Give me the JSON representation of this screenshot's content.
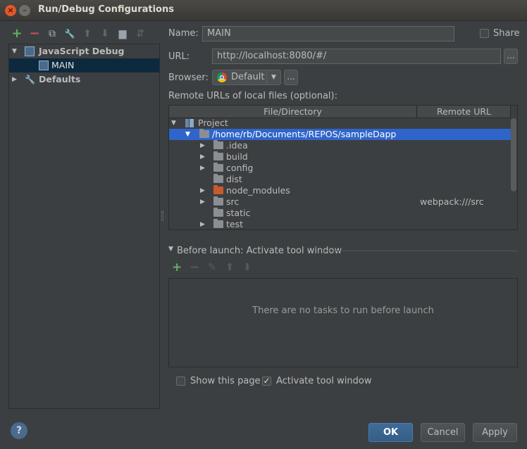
{
  "window": {
    "title": "Run/Debug Configurations",
    "close_glyph": "×",
    "min_glyph": "–"
  },
  "toolbar": {
    "add": "+",
    "remove": "−",
    "copy": "⧉",
    "edit": "🔧",
    "up": "⬆",
    "down": "⬇",
    "folder": "▆",
    "sort": "⇵"
  },
  "tree": {
    "items": [
      {
        "label": "JavaScript Debug",
        "expanded": true
      },
      {
        "label": "MAIN",
        "selected": true
      },
      {
        "label": "Defaults",
        "expanded": false
      }
    ]
  },
  "form": {
    "name_label": "Name:",
    "name_value": "MAIN",
    "share_label": "Share",
    "url_label": "URL:",
    "url_value": "http://localhost:8080/#/",
    "url_more": "...",
    "browser_label": "Browser:",
    "browser_value": "Default",
    "browser_more": "...",
    "remote_urls_label": "Remote URLs of local files (optional):"
  },
  "remote_table": {
    "columns": [
      "File/Directory",
      "Remote URL"
    ],
    "rows": [
      {
        "name": "Project",
        "remote": ""
      },
      {
        "name": "/home/rb/Documents/REPOS/sampleDapp",
        "remote": "",
        "selected": true
      },
      {
        "name": ".idea",
        "remote": ""
      },
      {
        "name": "build",
        "remote": ""
      },
      {
        "name": "config",
        "remote": ""
      },
      {
        "name": "dist",
        "remote": ""
      },
      {
        "name": "node_modules",
        "remote": ""
      },
      {
        "name": "src",
        "remote": "webpack:///src"
      },
      {
        "name": "static",
        "remote": ""
      },
      {
        "name": "test",
        "remote": ""
      }
    ]
  },
  "before_launch": {
    "header": "Before launch: Activate tool window",
    "empty_text": "There are no tasks to run before launch"
  },
  "options": {
    "show_page_label": "Show this page",
    "show_page_checked": false,
    "activate_label": "Activate tool window",
    "activate_checked": true
  },
  "buttons": {
    "ok": "OK",
    "cancel": "Cancel",
    "apply": "Apply",
    "help": "?"
  },
  "colors": {
    "accent": "#4a7bb0",
    "selection": "#0d293e",
    "table_selection": "#2f65ca",
    "folder": "#8a8f94",
    "folder_excluded": "#c75b2a",
    "add_green": "#5fb35f"
  }
}
